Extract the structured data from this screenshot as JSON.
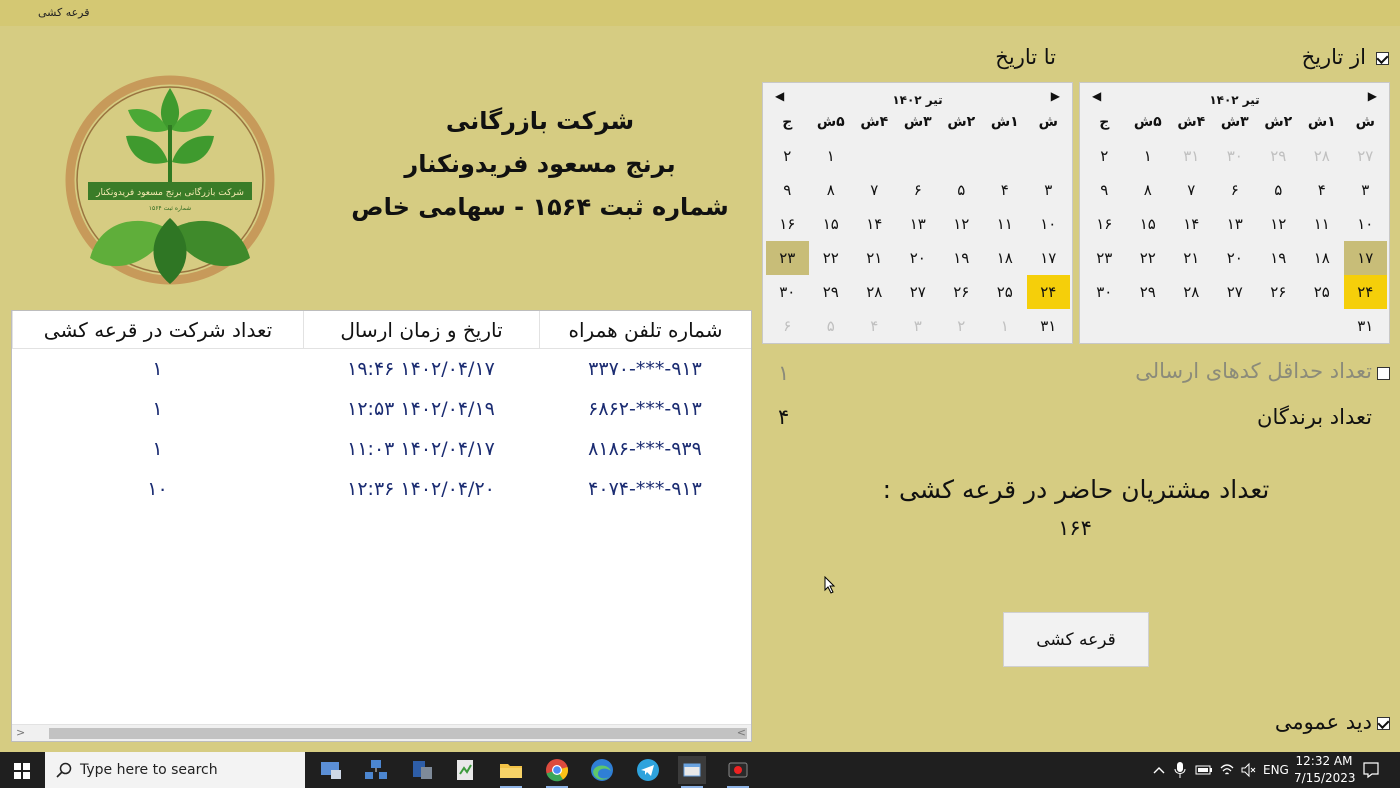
{
  "window": {
    "title": "قرعه کشی"
  },
  "company": {
    "line1": "شرکت بازرگانی",
    "line2": "برنج مسعود فریدونکنار",
    "line3": "شماره ثبت ۱۵۶۴ - سهامی خاص",
    "logo_text": "شرکت بازرگانی برنج مسعود فریدونکنار",
    "logo_subtext": "شماره ثبت ۱۵۶۴"
  },
  "date_from": {
    "label": "از تاریخ",
    "checked": true
  },
  "date_to": {
    "label": "تا تاریخ"
  },
  "calendar_from": {
    "month": "تیر ۱۴۰۲",
    "weekdays": [
      "ش",
      "۱ش",
      "۲ش",
      "۳ش",
      "۴ش",
      "۵ش",
      "ج"
    ],
    "rows": [
      [
        "۲۷",
        "۲۸",
        "۲۹",
        "۳۰",
        "۳۱",
        "۱",
        "۲"
      ],
      [
        "۳",
        "۴",
        "۵",
        "۶",
        "۷",
        "۸",
        "۹"
      ],
      [
        "۱۰",
        "۱۱",
        "۱۲",
        "۱۳",
        "۱۴",
        "۱۵",
        "۱۶"
      ],
      [
        "۱۷",
        "۱۸",
        "۱۹",
        "۲۰",
        "۲۱",
        "۲۲",
        "۲۳"
      ],
      [
        "۲۴",
        "۲۵",
        "۲۶",
        "۲۷",
        "۲۸",
        "۲۹",
        "۳۰"
      ],
      [
        "۳۱",
        "",
        "",
        "",
        "",
        "",
        ""
      ]
    ],
    "selected": "۲۴",
    "today": "۱۷"
  },
  "calendar_to": {
    "month": "تیر ۱۴۰۲",
    "weekdays": [
      "ش",
      "۱ش",
      "۲ش",
      "۳ش",
      "۴ش",
      "۵ش",
      "ج"
    ],
    "rows": [
      [
        "",
        "",
        "",
        "",
        "",
        "۱",
        "۲"
      ],
      [
        "۳",
        "۴",
        "۵",
        "۶",
        "۷",
        "۸",
        "۹"
      ],
      [
        "۱۰",
        "۱۱",
        "۱۲",
        "۱۳",
        "۱۴",
        "۱۵",
        "۱۶"
      ],
      [
        "۱۷",
        "۱۸",
        "۱۹",
        "۲۰",
        "۲۱",
        "۲۲",
        "۲۳"
      ],
      [
        "۲۴",
        "۲۵",
        "۲۶",
        "۲۷",
        "۲۸",
        "۲۹",
        "۳۰"
      ],
      [
        "۳۱",
        "۱",
        "۲",
        "۳",
        "۴",
        "۵",
        "۶"
      ]
    ],
    "selected": "۲۴",
    "today": "۲۳"
  },
  "min_codes": {
    "label": "تعداد حداقل کدهای ارسالی",
    "value": "۱",
    "checked": false
  },
  "winners": {
    "label": "تعداد برندگان",
    "value": "۴"
  },
  "participants": {
    "label": "تعداد مشتریان حاضر در قرعه کشی :",
    "value": "۱۶۴"
  },
  "draw_button": {
    "label": "قرعه کشی"
  },
  "overview": {
    "label": "دید عمومی",
    "checked": true
  },
  "table": {
    "columns": [
      "شماره تلفن همراه",
      "تاریخ و زمان ارسال",
      "تعداد شرکت در قرعه کشی"
    ],
    "rows": [
      [
        "۹۱۳-***-۳۳۷۰",
        "۱۴۰۲/۰۴/۱۷ ۱۹:۴۶",
        "۱"
      ],
      [
        "۹۱۳-***-۶۸۶۲",
        "۱۴۰۲/۰۴/۱۹ ۱۲:۵۳",
        "۱"
      ],
      [
        "۹۳۹-***-۸۱۸۶",
        "۱۴۰۲/۰۴/۱۷ ۱۱:۰۳",
        "۱"
      ],
      [
        "۹۱۳-***-۴۰۷۴",
        "۱۴۰۲/۰۴/۲۰ ۱۲:۳۶",
        "۱۰"
      ]
    ]
  },
  "taskbar": {
    "search_placeholder": "Type here to search",
    "language": "ENG",
    "time": "12:32 AM",
    "date": "7/15/2023"
  },
  "colors": {
    "background": "#d6cc82",
    "selected_day": "#f5cf0a",
    "table_text": "#1b2c72"
  }
}
